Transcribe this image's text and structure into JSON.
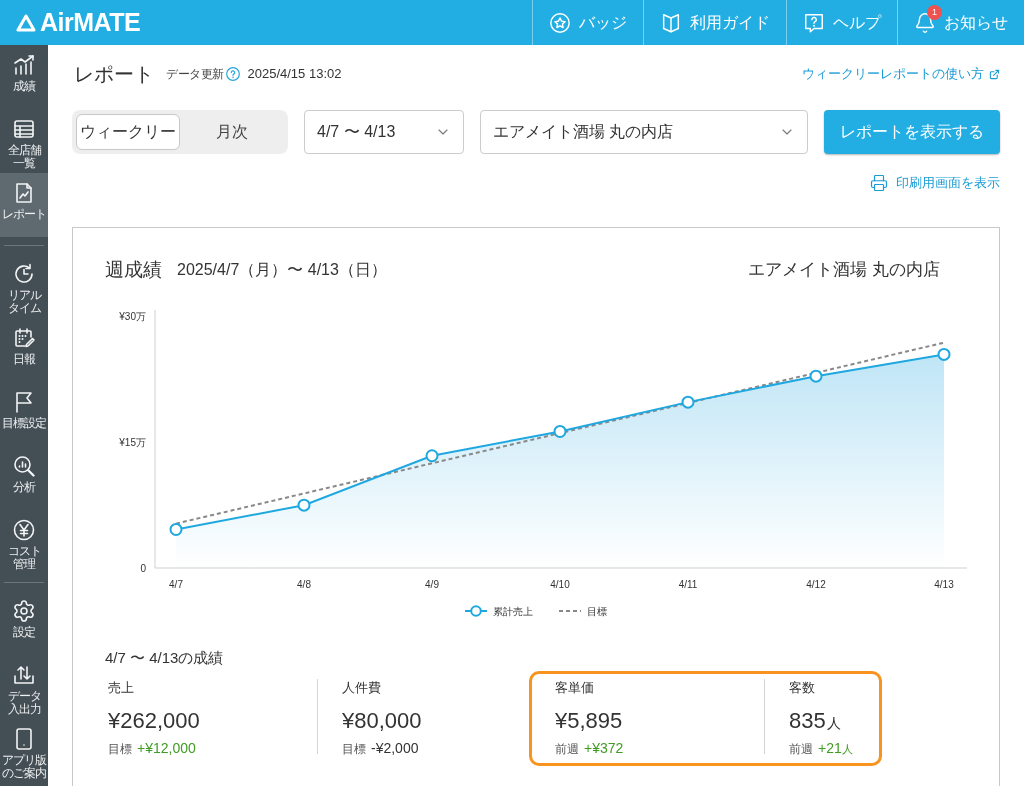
{
  "app": {
    "name": "AirMATE"
  },
  "header_menu": [
    {
      "label": "バッジ"
    },
    {
      "label": "利用ガイド"
    },
    {
      "label": "ヘルプ"
    },
    {
      "label": "お知らせ",
      "count": "1"
    }
  ],
  "sidebar": {
    "groups": [
      {
        "items": [
          {
            "label": "成績",
            "selected": false
          },
          {
            "label": "全店舗一覧",
            "selected": false
          },
          {
            "label": "レポート",
            "selected": true
          }
        ]
      },
      {
        "items": [
          {
            "label": "リアルタイム",
            "selected": false
          },
          {
            "label": "日報",
            "selected": false
          },
          {
            "label": "目標設定",
            "selected": false
          },
          {
            "label": "分析",
            "selected": false
          },
          {
            "label": "コスト管理",
            "selected": false
          }
        ]
      },
      {
        "items": [
          {
            "label": "設定",
            "selected": false
          },
          {
            "label": "データ入出力",
            "selected": false
          },
          {
            "label": "アプリ版のご案内",
            "selected": false
          }
        ]
      }
    ]
  },
  "page": {
    "title": "レポート",
    "updated_label": "データ更新",
    "updated_at": "2025/4/15 13:02",
    "guide_link": "ウィークリーレポートの使い方"
  },
  "controls": {
    "period_tabs": [
      {
        "label": "ウィークリー",
        "selected": true
      },
      {
        "label": "月次",
        "selected": false
      }
    ],
    "date_range": "4/7 〜 4/13",
    "store": "エアメイト酒場 丸の内店",
    "submit": "レポートを表示する",
    "print_link": "印刷用画面を表示"
  },
  "report": {
    "title": "週成績",
    "period": "2025/4/7（月）〜 4/13（日）",
    "store": "エアメイト酒場 丸の内店",
    "chart_data": {
      "type": "line",
      "categories": [
        "4/7",
        "4/8",
        "4/9",
        "4/10",
        "4/11",
        "4/12",
        "4/13"
      ],
      "series": [
        {
          "name": "累計売上",
          "type": "area",
          "line_style": "solid",
          "color": "#1fa8e0",
          "values": [
            4.6,
            7.5,
            13.4,
            16.3,
            19.8,
            22.9,
            25.5
          ]
        },
        {
          "name": "目標",
          "type": "line",
          "line_style": "dashed",
          "color": "#888888",
          "values": [
            5.3,
            8.9,
            12.5,
            16.1,
            19.7,
            23.3,
            26.9
          ]
        }
      ],
      "ylim": [
        0,
        30.8
      ],
      "yticks": [
        {
          "value": 0,
          "label": "0"
        },
        {
          "value": 15,
          "label": "¥15万"
        },
        {
          "value": 30,
          "label": "¥30万"
        }
      ],
      "legend": "bottom"
    },
    "summary": {
      "title": "4/7 〜 4/13の成績",
      "stats": [
        {
          "label": "売上",
          "value": "¥262,000",
          "compare_label": "目標",
          "delta": "+¥12,000",
          "favorable": true,
          "highlighted": false
        },
        {
          "label": "人件費",
          "value": "¥80,000",
          "compare_label": "目標",
          "delta": "-¥2,000",
          "favorable": false,
          "highlighted": false
        },
        {
          "label": "客単価",
          "value": "¥5,895",
          "compare_label": "前週",
          "delta": "+¥372",
          "favorable": true,
          "highlighted": true
        },
        {
          "label": "客数",
          "value": "835",
          "unit": "人",
          "compare_label": "前週",
          "delta": "+21",
          "delta_unit": "人",
          "favorable": true,
          "highlighted": true
        }
      ]
    }
  }
}
